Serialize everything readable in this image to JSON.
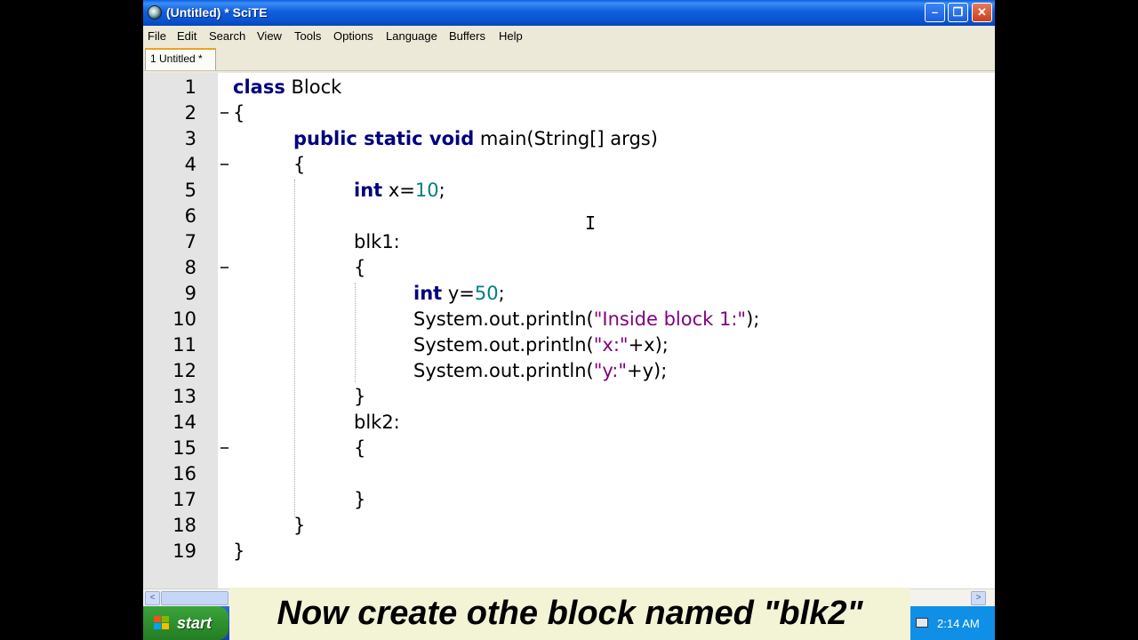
{
  "window": {
    "title": "(Untitled) * SciTE",
    "minimize": "–",
    "maximize": "❐",
    "close": "✕"
  },
  "menu": [
    "File",
    "Edit",
    "Search",
    "View",
    "Tools",
    "Options",
    "Language",
    "Buffers",
    "Help"
  ],
  "tabs": [
    {
      "label": "1 Untitled *"
    }
  ],
  "editor": {
    "line_numbers": [
      "1",
      "2",
      "3",
      "4",
      "5",
      "6",
      "7",
      "8",
      "9",
      "10",
      "11",
      "12",
      "13",
      "14",
      "15",
      "16",
      "17",
      "18",
      "19"
    ],
    "code": {
      "l1_kw": "class",
      "l1_rest": " Block",
      "l2": "{",
      "l3_kw": "public static void",
      "l3_rest": " main(String[] args)",
      "l4": "{",
      "l5_kw": "int",
      "l5_a": " x=",
      "l5_num": "10",
      "l5_b": ";",
      "l7": "blk1:",
      "l8": "{",
      "l9_kw": "int",
      "l9_a": " y=",
      "l9_num": "50",
      "l9_b": ";",
      "l10_a": "System.out.println(",
      "l10_str": "\"Inside block 1:\"",
      "l10_b": ");",
      "l11_a": "System.out.println(",
      "l11_str": "\"x:\"",
      "l11_b": "+x);",
      "l12_a": "System.out.println(",
      "l12_str": "\"y:\"",
      "l12_b": "+y);",
      "l13": "}",
      "l14": "blk2:",
      "l15": "{",
      "l17": "}",
      "l18": "}",
      "l19": "}"
    },
    "cursor_glyph": "I",
    "colors": {
      "keyword": "#00007f",
      "number": "#007f7f",
      "string": "#7f007f"
    }
  },
  "scrollbar": {
    "left_arrow": "<",
    "right_arrow": ">"
  },
  "taskbar": {
    "start_label": "start",
    "clock": "2:14 AM"
  },
  "caption": "Now create othe block named \"blk2\""
}
